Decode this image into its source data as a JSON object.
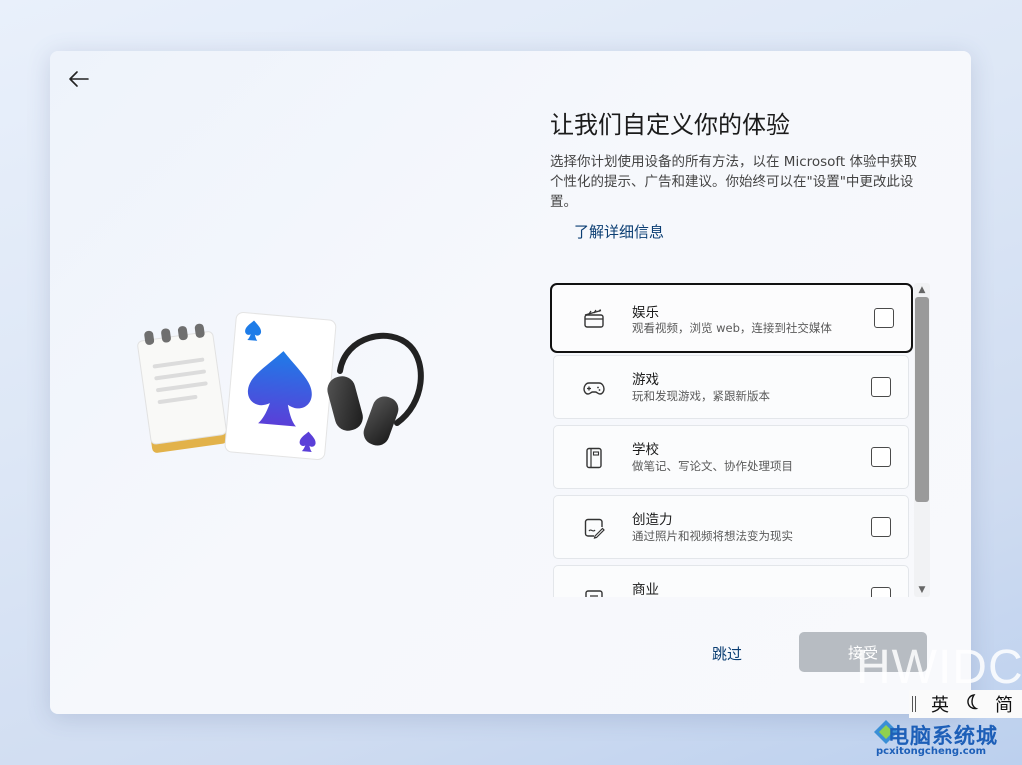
{
  "dialog": {
    "back_icon": "back-arrow-icon",
    "title": "让我们自定义你的体验",
    "description": "选择你计划使用设备的所有方法，以在 Microsoft 体验中获取个性化的提示、广告和建议。你始终可以在\"设置\"中更改此设置。",
    "learn_more": "了解详细信息",
    "options": [
      {
        "title": "娱乐",
        "subtitle": "观看视频，浏览 web，连接到社交媒体",
        "icon": "clapperboard-icon",
        "checked": false
      },
      {
        "title": "游戏",
        "subtitle": "玩和发现游戏，紧跟新版本",
        "icon": "gamepad-icon",
        "checked": false
      },
      {
        "title": "学校",
        "subtitle": "做笔记、写论文、协作处理项目",
        "icon": "notebook-icon",
        "checked": false
      },
      {
        "title": "创造力",
        "subtitle": "通过照片和视频将想法变为现实",
        "icon": "draw-icon",
        "checked": false
      },
      {
        "title": "商业",
        "subtitle": "",
        "icon": "briefcase-icon",
        "checked": false
      }
    ],
    "skip_label": "跳过",
    "accept_label": "接受",
    "colors": {
      "accent_link": "#0b3e73",
      "accept_disabled": "#b7bcc2"
    }
  },
  "watermark": {
    "text": "HWIDC"
  },
  "ime": {
    "lang": "英",
    "mode_icon": "moon-icon",
    "script": "简"
  },
  "brand_watermark": {
    "name": "电脑系统城",
    "url": "pcxitongcheng.com"
  }
}
